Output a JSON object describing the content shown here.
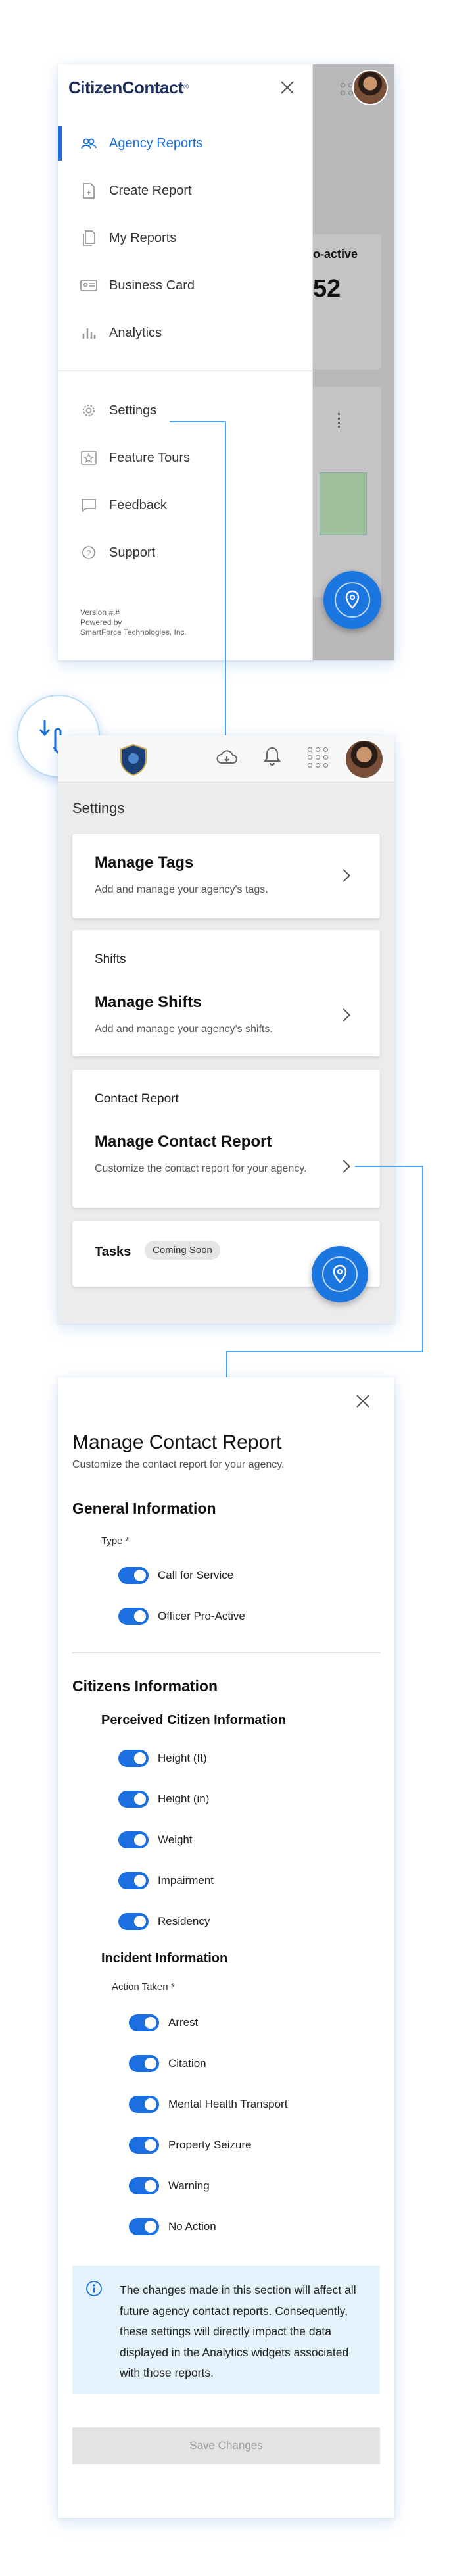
{
  "colors": {
    "accent": "#1a6fdc",
    "toggle_on": "#1b6fe0",
    "info_bg": "#e3f2fb",
    "connector": "#4aa6f0"
  },
  "menu": {
    "logo": "CitizenContact",
    "logo_mark": "®",
    "items": [
      {
        "label": "Agency Reports",
        "icon": "people-icon",
        "active": true
      },
      {
        "label": "Create Report",
        "icon": "create-report-icon"
      },
      {
        "label": "My Reports",
        "icon": "documents-icon"
      },
      {
        "label": "Business Card",
        "icon": "business-card-icon"
      },
      {
        "label": "Analytics",
        "icon": "bar-chart-icon"
      }
    ],
    "secondary": [
      {
        "label": "Settings",
        "icon": "gear-icon"
      },
      {
        "label": "Feature Tours",
        "icon": "star-icon"
      },
      {
        "label": "Feedback",
        "icon": "chat-icon"
      },
      {
        "label": "Support",
        "icon": "help-icon"
      }
    ],
    "version": "Version #.#",
    "powered_by": "Powered by",
    "company": "SmartForce Technologies, Inc."
  },
  "background_peek": {
    "card_label": "o-active",
    "card_value": "52"
  },
  "settings": {
    "title": "Settings",
    "cards": {
      "tags_title": "Manage Tags",
      "tags_sub": "Add and manage your agency's tags.",
      "shifts_section": "Shifts",
      "shifts_title": "Manage Shifts",
      "shifts_sub": "Add and manage your agency's shifts.",
      "contact_section": "Contact Report",
      "contact_title": "Manage Contact Report",
      "contact_sub": "Customize the contact report for your agency.",
      "tasks_title": "Tasks",
      "tasks_badge": "Coming Soon"
    }
  },
  "contact_report": {
    "title": "Manage Contact Report",
    "subtitle": "Customize the contact report for your agency.",
    "general_heading": "General Information",
    "type_label": "Type *",
    "type_options": [
      "Call for Service",
      "Officer Pro-Active"
    ],
    "citizens_heading": "Citizens Information",
    "perceived_heading": "Perceived Citizen Information",
    "perceived_options": [
      "Height (ft)",
      "Height (in)",
      "Weight",
      "Impairment",
      "Residency"
    ],
    "incident_heading": "Incident Information",
    "action_label": "Action Taken *",
    "action_options": [
      "Arrest",
      "Citation",
      "Mental Health Transport",
      "Property Seizure",
      "Warning",
      "No Action"
    ],
    "info_text": "The changes made in this section will affect all future agency contact reports. Consequently, these settings will directly impact the data displayed in the Analytics widgets associated with those reports.",
    "save_label": "Save Changes"
  }
}
